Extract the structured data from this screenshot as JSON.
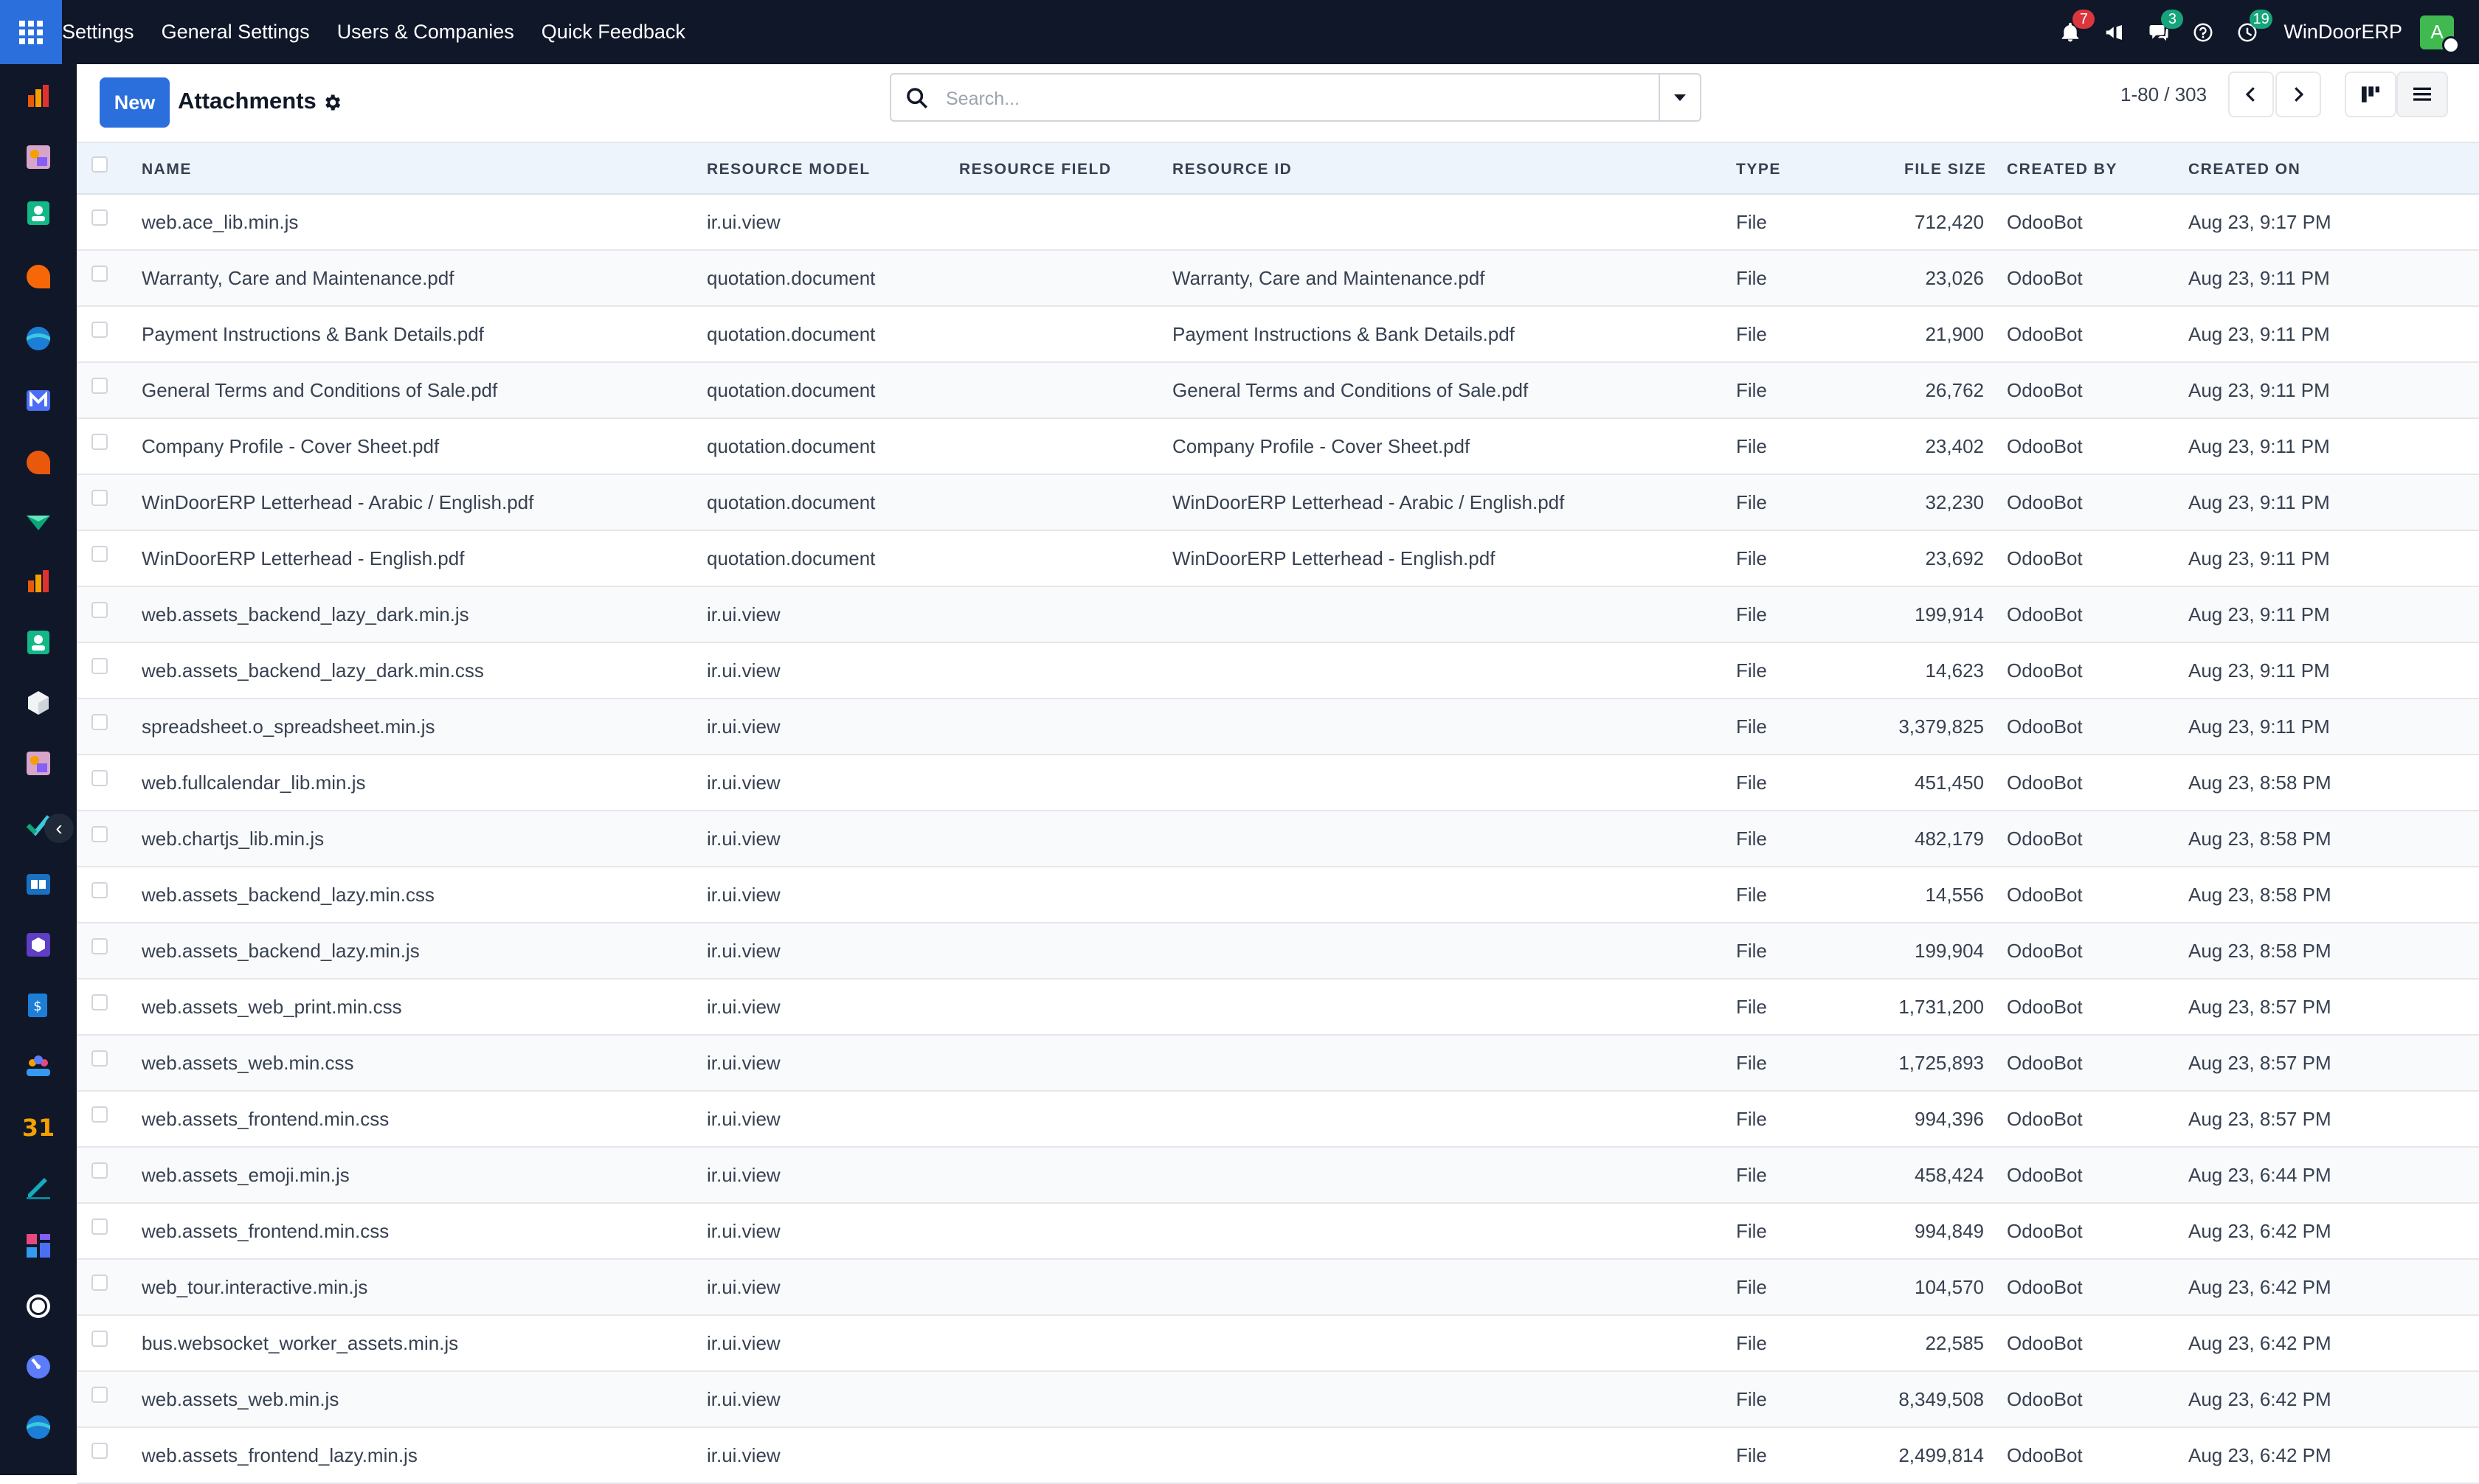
{
  "topbar": {
    "menu": [
      "Settings",
      "General Settings",
      "Users & Companies",
      "Quick Feedback"
    ],
    "notifications_count": "7",
    "messages_count": "3",
    "activities_count": "19",
    "company": "WinDoorERP",
    "avatar_letter": "A"
  },
  "control": {
    "new_label": "New",
    "title": "Attachments",
    "search_placeholder": "Search...",
    "pager": "1-80 / 303"
  },
  "columns": [
    "NAME",
    "RESOURCE MODEL",
    "RESOURCE FIELD",
    "RESOURCE ID",
    "TYPE",
    "FILE SIZE",
    "CREATED BY",
    "CREATED ON"
  ],
  "rows": [
    {
      "name": "web.ace_lib.min.js",
      "model": "ir.ui.view",
      "field": "",
      "res_id": "",
      "type": "File",
      "size": "712,420",
      "by": "OdooBot",
      "on": "Aug 23, 9:17 PM"
    },
    {
      "name": "Warranty, Care and Maintenance.pdf",
      "model": "quotation.document",
      "field": "",
      "res_id": "Warranty, Care and Maintenance.pdf",
      "type": "File",
      "size": "23,026",
      "by": "OdooBot",
      "on": "Aug 23, 9:11 PM"
    },
    {
      "name": "Payment Instructions & Bank Details.pdf",
      "model": "quotation.document",
      "field": "",
      "res_id": "Payment Instructions & Bank Details.pdf",
      "type": "File",
      "size": "21,900",
      "by": "OdooBot",
      "on": "Aug 23, 9:11 PM"
    },
    {
      "name": "General Terms and Conditions of Sale.pdf",
      "model": "quotation.document",
      "field": "",
      "res_id": "General Terms and Conditions of Sale.pdf",
      "type": "File",
      "size": "26,762",
      "by": "OdooBot",
      "on": "Aug 23, 9:11 PM"
    },
    {
      "name": "Company Profile - Cover Sheet.pdf",
      "model": "quotation.document",
      "field": "",
      "res_id": "Company Profile - Cover Sheet.pdf",
      "type": "File",
      "size": "23,402",
      "by": "OdooBot",
      "on": "Aug 23, 9:11 PM"
    },
    {
      "name": "WinDoorERP Letterhead - Arabic / English.pdf",
      "model": "quotation.document",
      "field": "",
      "res_id": "WinDoorERP Letterhead - Arabic / English.pdf",
      "type": "File",
      "size": "32,230",
      "by": "OdooBot",
      "on": "Aug 23, 9:11 PM"
    },
    {
      "name": "WinDoorERP Letterhead - English.pdf",
      "model": "quotation.document",
      "field": "",
      "res_id": "WinDoorERP Letterhead - English.pdf",
      "type": "File",
      "size": "23,692",
      "by": "OdooBot",
      "on": "Aug 23, 9:11 PM"
    },
    {
      "name": "web.assets_backend_lazy_dark.min.js",
      "model": "ir.ui.view",
      "field": "",
      "res_id": "",
      "type": "File",
      "size": "199,914",
      "by": "OdooBot",
      "on": "Aug 23, 9:11 PM"
    },
    {
      "name": "web.assets_backend_lazy_dark.min.css",
      "model": "ir.ui.view",
      "field": "",
      "res_id": "",
      "type": "File",
      "size": "14,623",
      "by": "OdooBot",
      "on": "Aug 23, 9:11 PM"
    },
    {
      "name": "spreadsheet.o_spreadsheet.min.js",
      "model": "ir.ui.view",
      "field": "",
      "res_id": "",
      "type": "File",
      "size": "3,379,825",
      "by": "OdooBot",
      "on": "Aug 23, 9:11 PM"
    },
    {
      "name": "web.fullcalendar_lib.min.js",
      "model": "ir.ui.view",
      "field": "",
      "res_id": "",
      "type": "File",
      "size": "451,450",
      "by": "OdooBot",
      "on": "Aug 23, 8:58 PM"
    },
    {
      "name": "web.chartjs_lib.min.js",
      "model": "ir.ui.view",
      "field": "",
      "res_id": "",
      "type": "File",
      "size": "482,179",
      "by": "OdooBot",
      "on": "Aug 23, 8:58 PM"
    },
    {
      "name": "web.assets_backend_lazy.min.css",
      "model": "ir.ui.view",
      "field": "",
      "res_id": "",
      "type": "File",
      "size": "14,556",
      "by": "OdooBot",
      "on": "Aug 23, 8:58 PM"
    },
    {
      "name": "web.assets_backend_lazy.min.js",
      "model": "ir.ui.view",
      "field": "",
      "res_id": "",
      "type": "File",
      "size": "199,904",
      "by": "OdooBot",
      "on": "Aug 23, 8:58 PM"
    },
    {
      "name": "web.assets_web_print.min.css",
      "model": "ir.ui.view",
      "field": "",
      "res_id": "",
      "type": "File",
      "size": "1,731,200",
      "by": "OdooBot",
      "on": "Aug 23, 8:57 PM"
    },
    {
      "name": "web.assets_web.min.css",
      "model": "ir.ui.view",
      "field": "",
      "res_id": "",
      "type": "File",
      "size": "1,725,893",
      "by": "OdooBot",
      "on": "Aug 23, 8:57 PM"
    },
    {
      "name": "web.assets_frontend.min.css",
      "model": "ir.ui.view",
      "field": "",
      "res_id": "",
      "type": "File",
      "size": "994,396",
      "by": "OdooBot",
      "on": "Aug 23, 8:57 PM"
    },
    {
      "name": "web.assets_emoji.min.js",
      "model": "ir.ui.view",
      "field": "",
      "res_id": "",
      "type": "File",
      "size": "458,424",
      "by": "OdooBot",
      "on": "Aug 23, 6:44 PM"
    },
    {
      "name": "web.assets_frontend.min.css",
      "model": "ir.ui.view",
      "field": "",
      "res_id": "",
      "type": "File",
      "size": "994,849",
      "by": "OdooBot",
      "on": "Aug 23, 6:42 PM"
    },
    {
      "name": "web_tour.interactive.min.js",
      "model": "ir.ui.view",
      "field": "",
      "res_id": "",
      "type": "File",
      "size": "104,570",
      "by": "OdooBot",
      "on": "Aug 23, 6:42 PM"
    },
    {
      "name": "bus.websocket_worker_assets.min.js",
      "model": "ir.ui.view",
      "field": "",
      "res_id": "",
      "type": "File",
      "size": "22,585",
      "by": "OdooBot",
      "on": "Aug 23, 6:42 PM"
    },
    {
      "name": "web.assets_web.min.js",
      "model": "ir.ui.view",
      "field": "",
      "res_id": "",
      "type": "File",
      "size": "8,349,508",
      "by": "OdooBot",
      "on": "Aug 23, 6:42 PM"
    },
    {
      "name": "web.assets_frontend_lazy.min.js",
      "model": "ir.ui.view",
      "field": "",
      "res_id": "",
      "type": "File",
      "size": "2,499,814",
      "by": "OdooBot",
      "on": "Aug 23, 6:42 PM"
    }
  ],
  "sidebar_apps": [
    "dashboard-app-icon",
    "studio-app-icon",
    "contacts-app-icon",
    "discuss-app-icon",
    "odoo-app-icon",
    "email-marketing-app-icon",
    "chat-app-icon",
    "crm-app-icon",
    "reporting-app-icon",
    "employees-app-icon",
    "inventory-app-icon",
    "studio-app-icon",
    "project-app-icon",
    "knowledge-app-icon",
    "products-app-icon",
    "invoicing-app-icon",
    "team-app-icon",
    "calendar-app-icon",
    "sign-app-icon",
    "dashboards-app-icon",
    "whatsapp-app-icon",
    "timesheet-app-icon",
    "odoo-app-icon"
  ],
  "colors": {
    "topbar": "#0f1729",
    "primary": "#2b6fdd",
    "header_bg": "#eef4fc"
  }
}
